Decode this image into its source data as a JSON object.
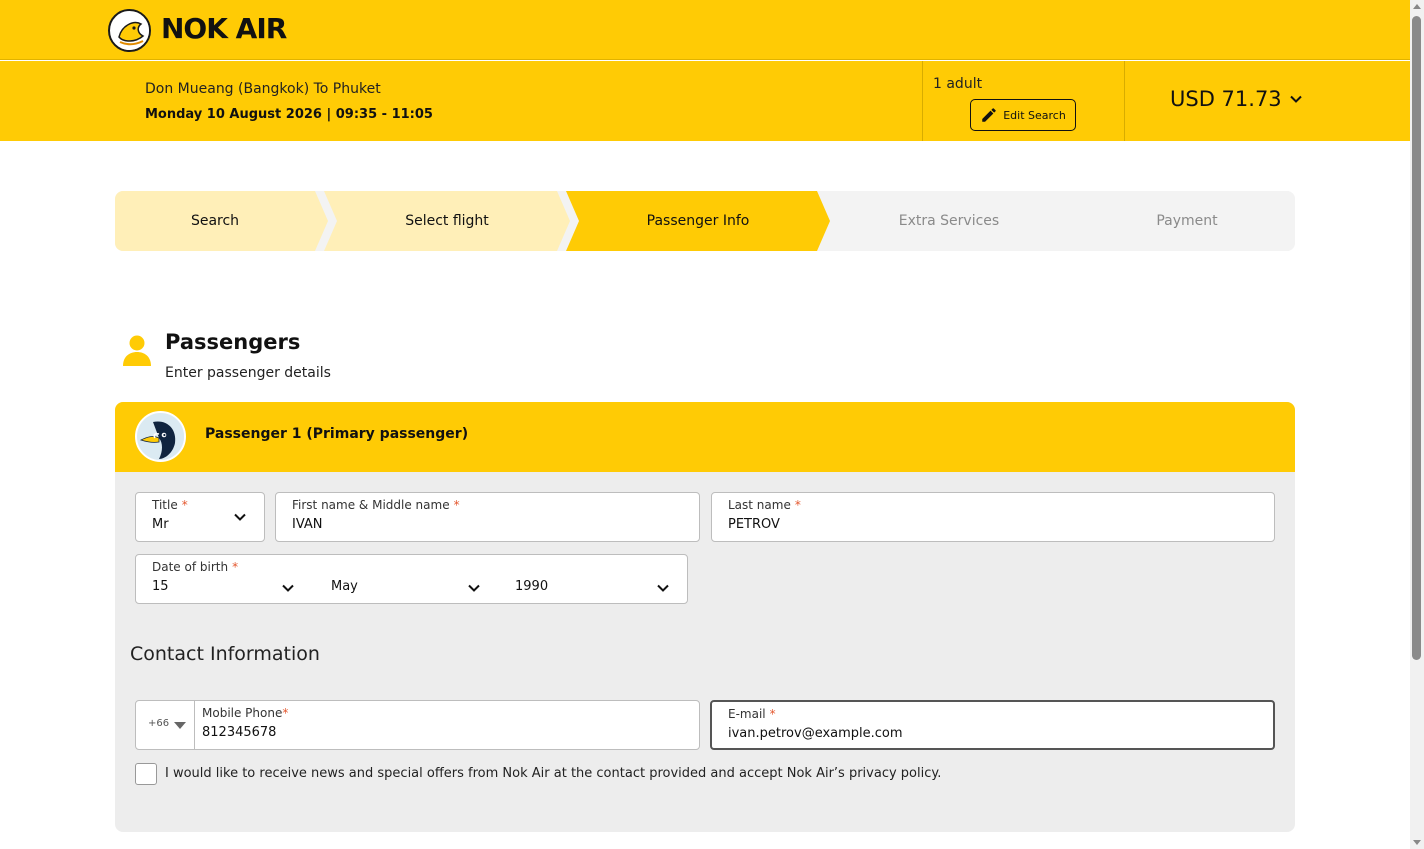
{
  "brand": {
    "name": "NOK AIR",
    "accent": "#FFCB05"
  },
  "summary": {
    "route": "Don Mueang (Bangkok) To Phuket",
    "datetime": "Monday 10 August 2026 | 09:35 - 11:05",
    "passengers": "1 adult",
    "edit_label": "Edit Search",
    "price": "USD 71.73"
  },
  "steps": [
    {
      "label": "Search",
      "state": "done"
    },
    {
      "label": "Select flight",
      "state": "done"
    },
    {
      "label": "Passenger Info",
      "state": "active"
    },
    {
      "label": "Extra Services",
      "state": "pending"
    },
    {
      "label": "Payment",
      "state": "pending"
    }
  ],
  "passengers": {
    "title": "Passengers",
    "subtitle": "Enter passenger details",
    "card_title": "Passenger 1 (Primary passenger)",
    "title_field": {
      "label": "Title",
      "value": "Mr"
    },
    "first_name": {
      "label": "First name & Middle name",
      "value": "IVAN"
    },
    "last_name": {
      "label": "Last name",
      "value": "PETROV"
    },
    "dob": {
      "label": "Date of birth",
      "day": "15",
      "month": "May",
      "year": "1990"
    },
    "required_mark": "*"
  },
  "contact": {
    "title": "Contact Information",
    "country_code": "+66",
    "phone": {
      "label": "Mobile Phone",
      "value": "812345678"
    },
    "email": {
      "label": "E-mail",
      "value": "ivan.petrov@example.com"
    },
    "consent": "I would like to receive news and special offers from Nok Air at the contact provided and accept Nok Air’s privacy policy."
  }
}
